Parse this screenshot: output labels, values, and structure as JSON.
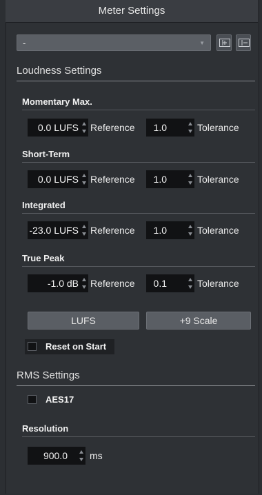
{
  "panel": {
    "title": "Meter Settings"
  },
  "preset": {
    "value": "-"
  },
  "loudness": {
    "header": "Loudness Settings",
    "groups": [
      {
        "name": "Momentary Max.",
        "value": "0.0 LUFS",
        "reference_label": "Reference",
        "tolerance": "1.0",
        "tolerance_label": "Tolerance"
      },
      {
        "name": "Short-Term",
        "value": "0.0 LUFS",
        "reference_label": "Reference",
        "tolerance": "1.0",
        "tolerance_label": "Tolerance"
      },
      {
        "name": "Integrated",
        "value": "-23.0 LUFS",
        "reference_label": "Reference",
        "tolerance": "1.0",
        "tolerance_label": "Tolerance"
      },
      {
        "name": "True Peak",
        "value": "-1.0 dB",
        "reference_label": "Reference",
        "tolerance": "0.1",
        "tolerance_label": "Tolerance"
      }
    ],
    "lufs_button": "LUFS",
    "scale_button": "+9 Scale",
    "reset_label": "Reset on Start"
  },
  "rms": {
    "header": "RMS Settings",
    "aes17_label": "AES17",
    "resolution_header": "Resolution",
    "resolution_value": "900.0",
    "resolution_unit": "ms"
  }
}
